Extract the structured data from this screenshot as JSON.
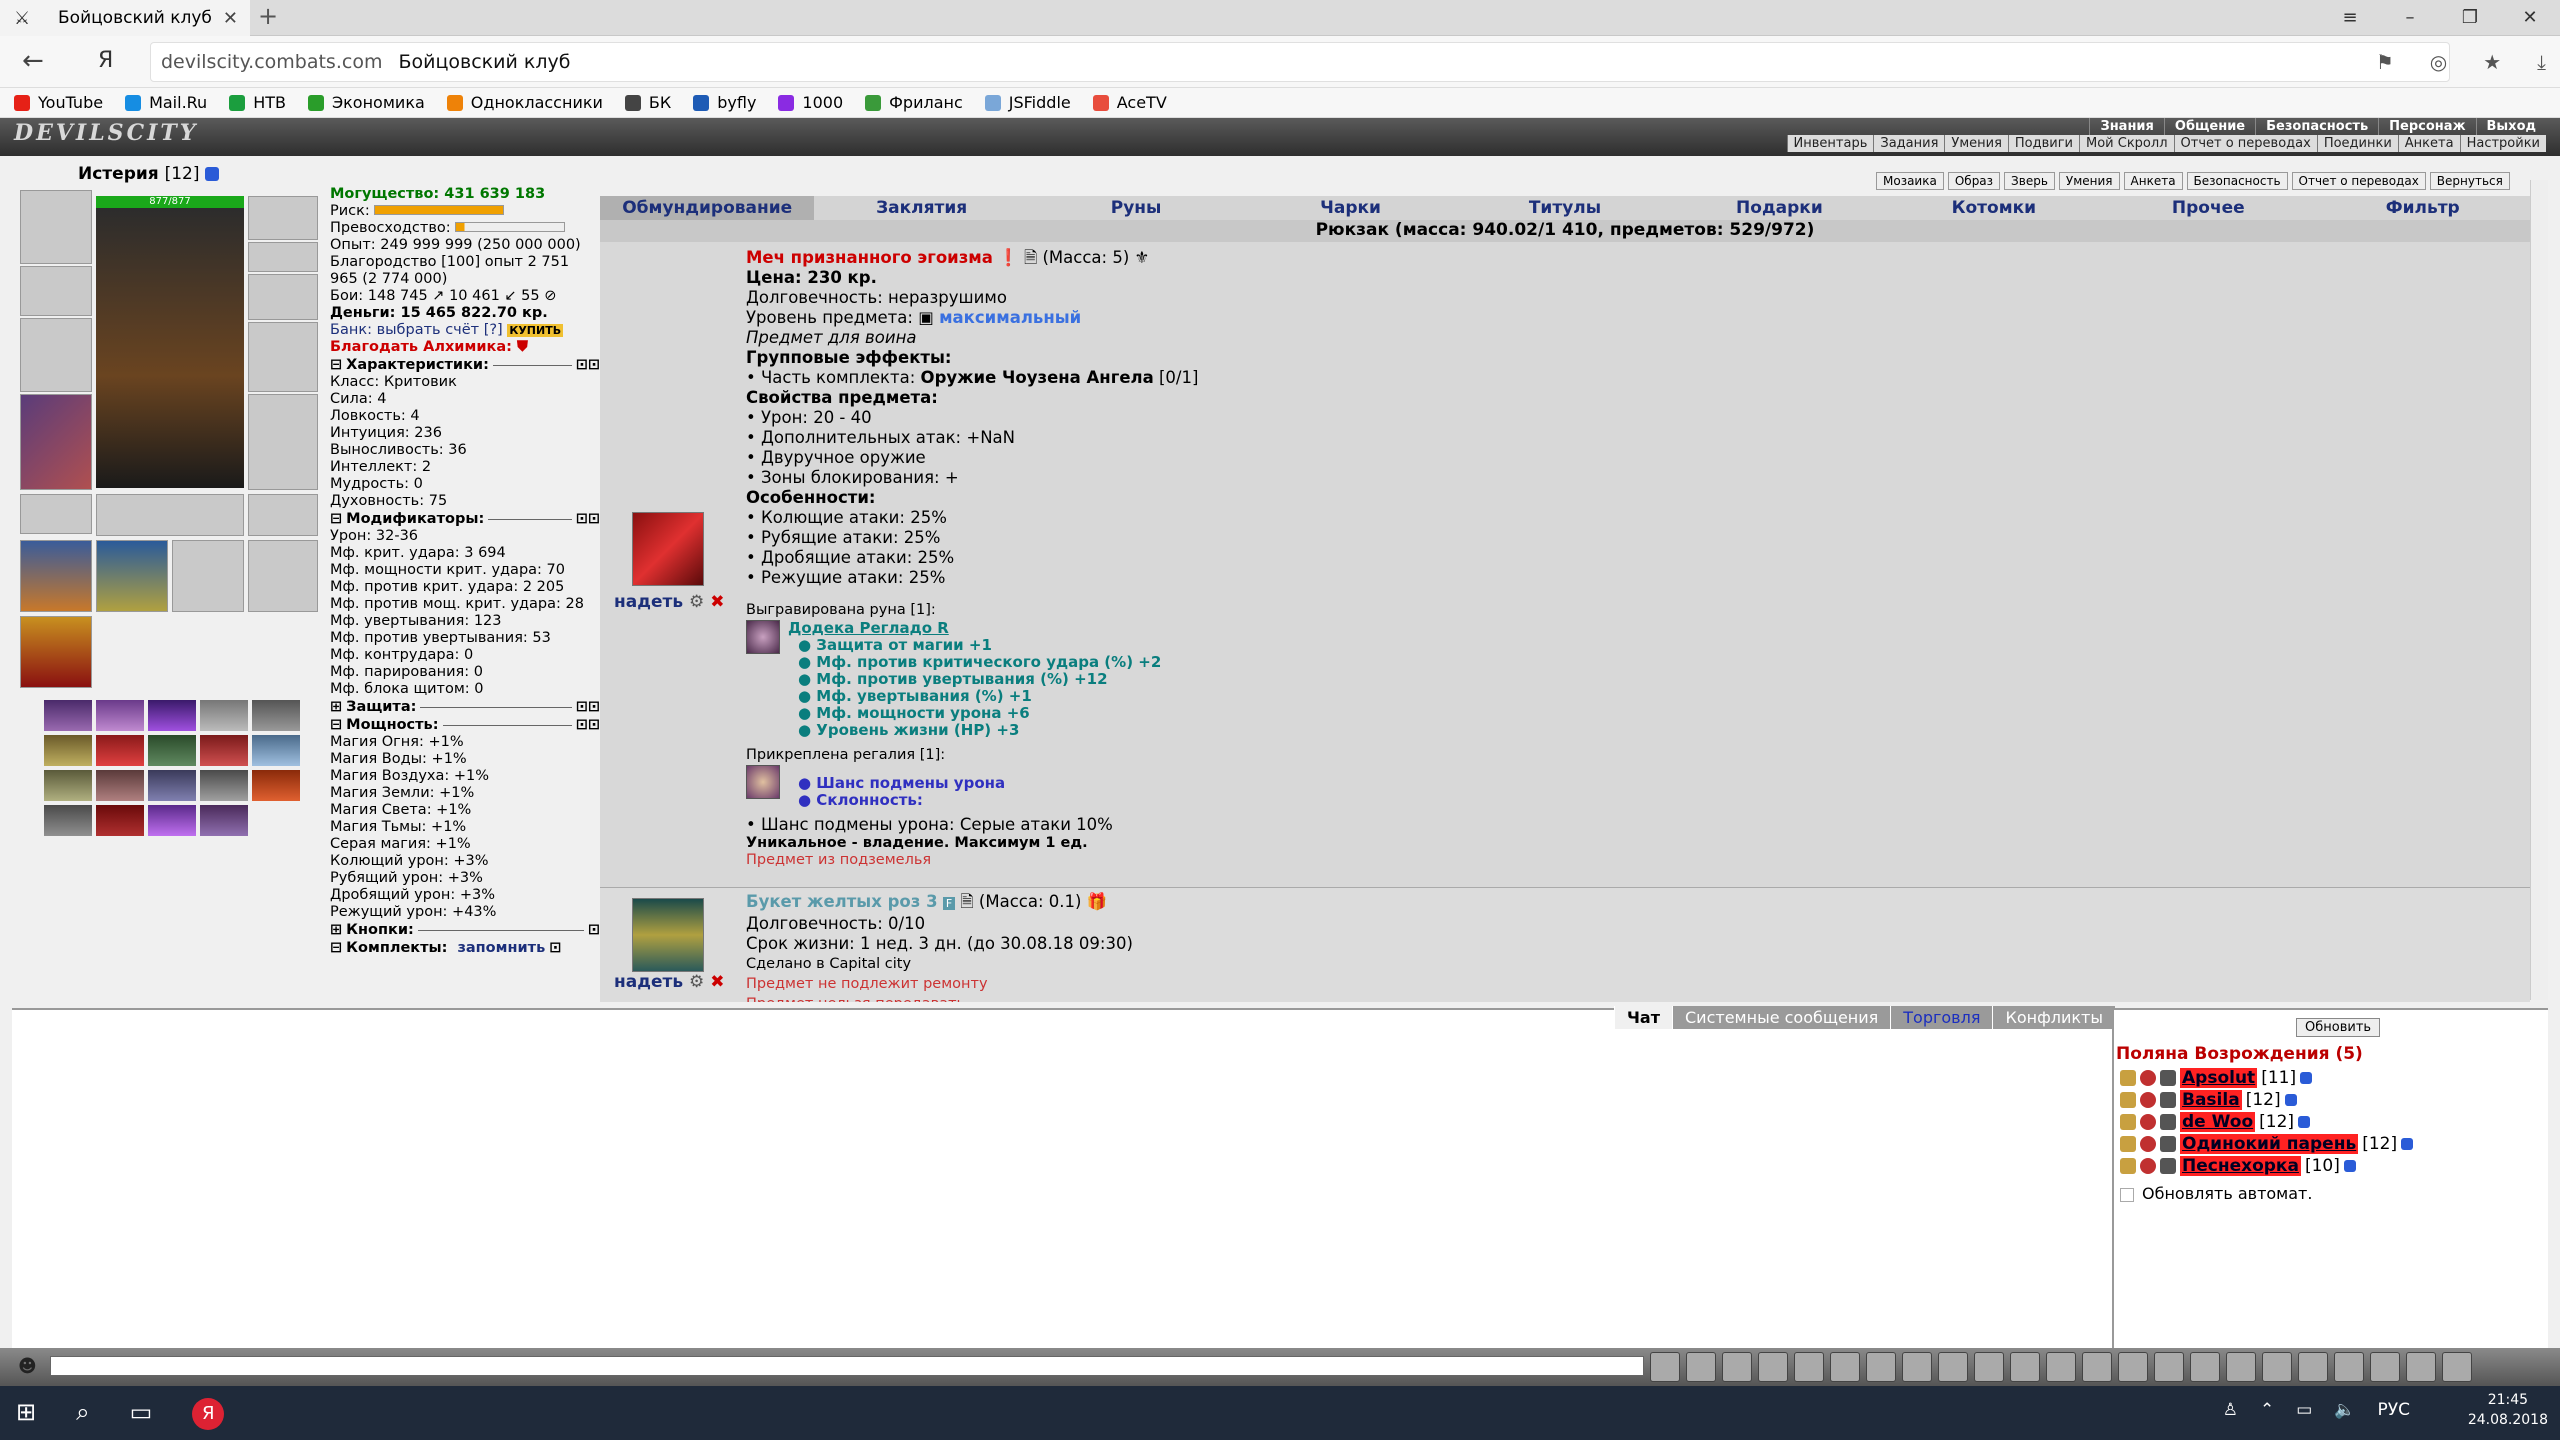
{
  "browser": {
    "tab_title": "Бойцовский клуб",
    "url_domain": "devilscity.combats.com",
    "url_title": "Бойцовский клуб",
    "ya_label": "Я",
    "bookmarks": [
      {
        "label": "YouTube",
        "color": "#e62117"
      },
      {
        "label": "Mail.Ru",
        "color": "#168de2"
      },
      {
        "label": "НТВ",
        "color": "#1b9e3e"
      },
      {
        "label": "Экономика",
        "color": "#2a9d2a"
      },
      {
        "label": "Одноклассники",
        "color": "#ee8208"
      },
      {
        "label": "БК",
        "color": "#444444"
      },
      {
        "label": "byfly",
        "color": "#1e5bb5"
      },
      {
        "label": "1000",
        "color": "#8a2be2"
      },
      {
        "label": "Фриланс",
        "color": "#3a9a3a"
      },
      {
        "label": "JSFiddle",
        "color": "#7aa7d8"
      },
      {
        "label": "AceTV",
        "color": "#e84d3d"
      }
    ]
  },
  "game": {
    "logo": "DEVILSCITY",
    "top_menu": [
      "Знания",
      "Общение",
      "Безопасность",
      "Персонаж",
      "Выход"
    ],
    "sub_menu": [
      "Инвентарь",
      "Задания",
      "Умения",
      "Подвиги",
      "Мой Скролл",
      "Отчет о переводах",
      "Поединки",
      "Анкета",
      "Настройки"
    ],
    "player": {
      "name": "Истерия",
      "level": "[12]",
      "hp": "877/877"
    },
    "stats": {
      "power": "Могущество: 431 639 183",
      "risk": "Риск:",
      "superiority": "Превосходство:",
      "exp": "Опыт: 249 999 999 (250 000 000)",
      "blag": "Благородство [100] опыт 2 751 965 (2 774 000)",
      "fights": "Бои: 148 745 ↗ 10 461 ↙ 55 ⊘",
      "money": "Деньги: 15 465 822.70 кр.",
      "bank": "Банк: выбрать счёт [?]",
      "buy": "КУПИТЬ",
      "alch": "Благодать Алхимика:",
      "char_head": "Характеристики:",
      "char": [
        "Класс: Критовик",
        "Сила: 4",
        "Ловкость: 4",
        "Интуиция: 236",
        "Выносливость: 36",
        "Интеллект: 2",
        "Мудрость: 0",
        "Духовность: 75"
      ],
      "mod_head": "Модификаторы:",
      "mods": [
        "Урон: 32-36",
        "Мф. крит. удара: 3 694",
        "Мф. мощности крит. удара: 70",
        "Мф. против крит. удара: 2 205",
        "Мф. против мощ. крит. удара: 28",
        "Мф. увертывания: 123",
        "Мф. против увертывания: 53",
        "Мф. контрудара: 0",
        "Мф. парирования: 0",
        "Мф. блока щитом: 0"
      ],
      "def_head": "Защита:",
      "pow_head": "Мощность:",
      "powers": [
        "Магия Огня: +1%",
        "Магия Воды: +1%",
        "Магия Воздуха: +1%",
        "Магия Земли: +1%",
        "Магия Света: +1%",
        "Магия Тьмы: +1%",
        "Серая магия: +1%",
        "Колющий урон: +3%",
        "Рубящий урон: +3%",
        "Дробящий урон: +3%",
        "Режущий урон: +43%"
      ],
      "btn_head": "Кнопки:",
      "set_head": "Комплекты:",
      "remember": "запомнить"
    },
    "buttons": [
      "Мозаика",
      "Образ",
      "Зверь",
      "Умения",
      "Анкета",
      "Безопасность",
      "Отчет о переводах",
      "Вернуться"
    ],
    "categories": [
      "Обмундирование",
      "Заклятия",
      "Руны",
      "Чарки",
      "Титулы",
      "Подарки",
      "Котомки",
      "Прочее",
      "Фильтр"
    ],
    "bag": "Рюкзак (масса: 940.02/1 410, предметов: 529/972)",
    "item1": {
      "name": "Меч признанного эгоизма",
      "mass": "(Масса: 5)",
      "price": "Цена: 230 кр.",
      "dur": "Долговечность: неразрушимо",
      "level_label": "Уровень предмета:",
      "level_val": "максимальный",
      "for": "Предмет для воина",
      "group_head": "Групповые эффекты:",
      "set_part": "• Часть комплекта:",
      "set_name": "Оружие Чоузена Ангела",
      "set_cnt": "[0/1]",
      "props_head": "Свойства предмета:",
      "props": [
        "• Урон: 20 - 40",
        "• Дополнительных атак: +NaN",
        "• Двуручное оружие",
        "• Зоны блокирования: +"
      ],
      "feat_head": "Особенности:",
      "feats": [
        "• Колющие атаки: 25%",
        "• Рубящие атаки: 25%",
        "• Дробящие атаки: 25%",
        "• Режущие атаки: 25%"
      ],
      "rune_head": "Выгравирована руна [1]:",
      "rune_name": "Додека Регладо R",
      "rune_props": [
        "● Защита от магии +1",
        "● Мф. против критического удара (%) +2",
        "● Мф. против увертывания (%) +12",
        "● Мф. увертывания (%) +1",
        "● Мф. мощности урона +6",
        "● Уровень жизни (HP) +3"
      ],
      "reg_head": "Прикреплена регалия [1]:",
      "reg_props": [
        "● Шанс подмены урона",
        "● Склонность:"
      ],
      "chance": "• Шанс подмены урона: Серые атаки 10%",
      "unique": "Уникальное - владение. Максимум 1 ед.",
      "origin": "Предмет из подземелья",
      "put": "надеть"
    },
    "item2": {
      "name": "Букет желтых роз 3",
      "mass": "(Масса: 0.1)",
      "dur": "Долговечность: 0/10",
      "life": "Срок жизни: 1 нед. 3 дн. (до 30.08.18 09:30)",
      "made": "Сделано в Capital city",
      "norepair": "Предмет не подлежит ремонту",
      "notransfer": "Предмет нельзя передавать",
      "put": "надеть"
    },
    "chat_tabs": [
      "Чат",
      "Системные сообщения",
      "Торговля",
      "Конфликты"
    ],
    "refresh": "Обновить",
    "location": "Поляна Возрождения (5)",
    "players": [
      {
        "name": "Apsolut",
        "level": "[11]"
      },
      {
        "name": "Basila",
        "level": "[12]"
      },
      {
        "name": "de Woo",
        "level": "[12]"
      },
      {
        "name": "Одинокий парень",
        "level": "[12]"
      },
      {
        "name": "Песнехорка",
        "level": "[10]"
      }
    ],
    "autorefresh": "Обновлять автомат."
  },
  "taskbar": {
    "lang": "РУС",
    "time": "21:45",
    "date": "24.08.2018"
  }
}
